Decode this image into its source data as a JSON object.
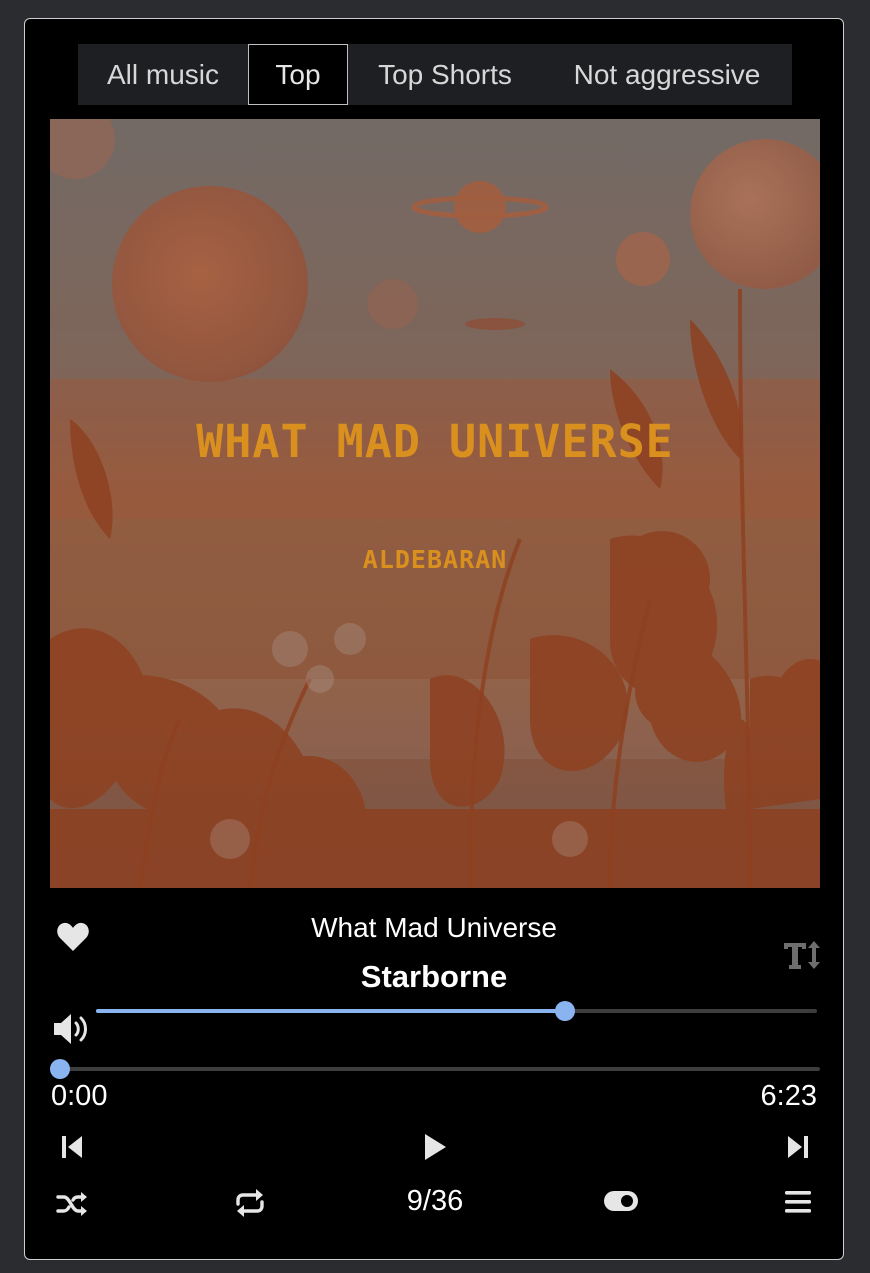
{
  "tabs": [
    "All music",
    "Top",
    "Top Shorts",
    "Not aggressive"
  ],
  "active_tab": "Top",
  "artwork": {
    "title": "WHAT MAD UNIVERSE",
    "artist": "ALDEBARAN"
  },
  "track": {
    "album": "What Mad Universe",
    "title": "Starborne"
  },
  "volume_fraction": 0.65,
  "progress_fraction": 0.0,
  "time": {
    "current": "0:00",
    "duration": "6:23"
  },
  "counter": "9/36",
  "colors": {
    "accent": "#8ab4f0",
    "background": "#000000",
    "frame": "#2b2c2f",
    "artwork_tint": "#b5461a",
    "artwork_text": "#d9901e"
  },
  "icons": {
    "favorite": "heart-icon",
    "lyrics": "text-size-icon",
    "volume": "volume-icon",
    "previous": "skip-previous-icon",
    "play": "play-icon",
    "next": "skip-next-icon",
    "shuffle": "shuffle-icon",
    "repeat": "repeat-icon",
    "toggle": "toggle-icon",
    "menu": "menu-icon"
  }
}
